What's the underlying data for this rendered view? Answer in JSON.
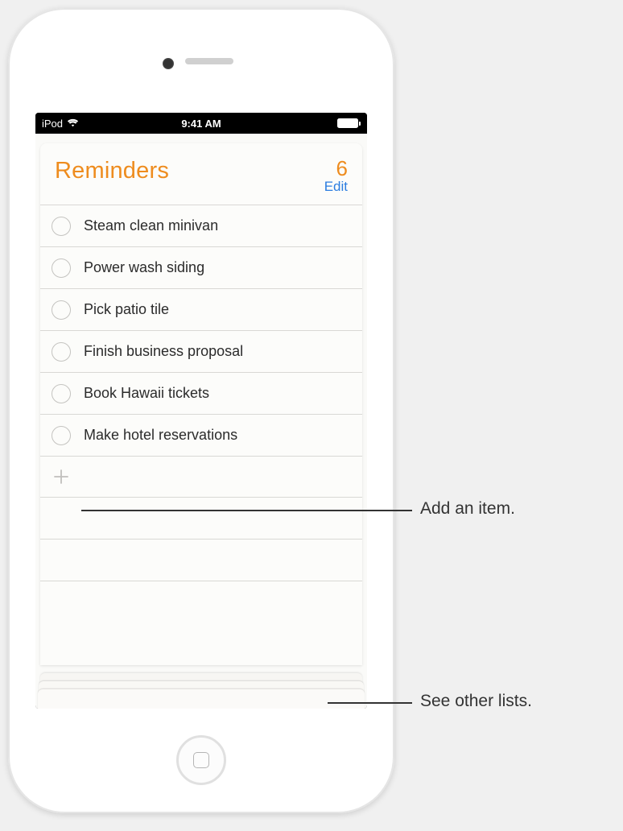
{
  "statusBar": {
    "device": "iPod",
    "time": "9:41 AM"
  },
  "header": {
    "title": "Reminders",
    "count": "6",
    "edit": "Edit"
  },
  "reminders": [
    {
      "text": "Steam clean minivan"
    },
    {
      "text": "Power wash siding"
    },
    {
      "text": "Pick patio tile"
    },
    {
      "text": "Finish business proposal"
    },
    {
      "text": "Book Hawaii tickets"
    },
    {
      "text": "Make hotel reservations"
    }
  ],
  "callouts": {
    "addItem": "Add an item.",
    "seeLists": "See other lists."
  }
}
